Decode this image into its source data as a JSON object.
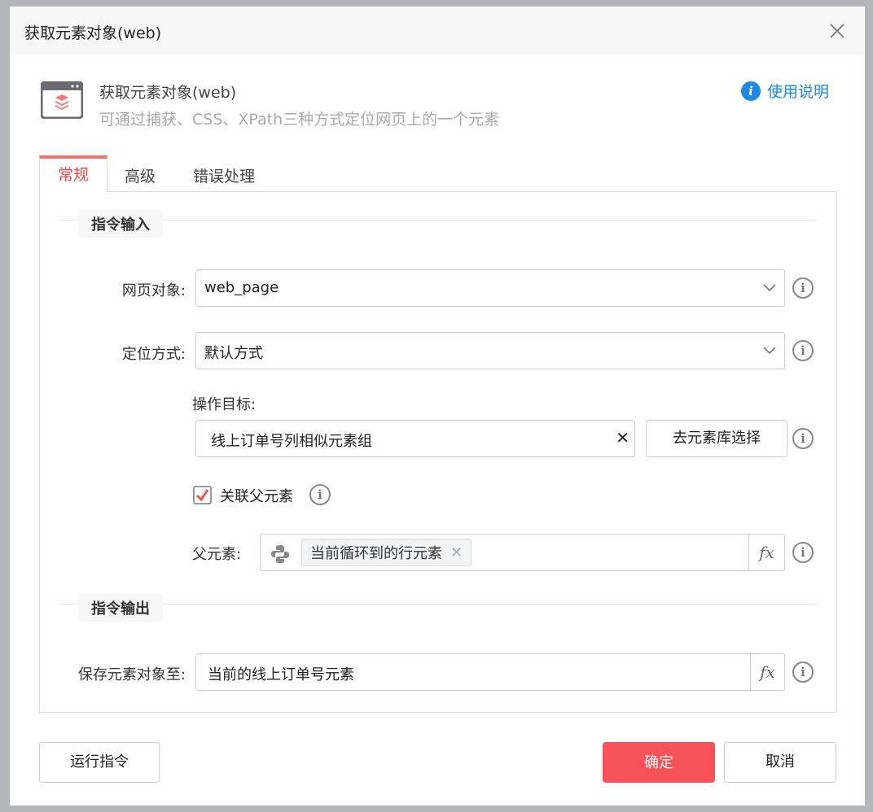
{
  "dialog": {
    "title": "获取元素对象(web)",
    "close_icon": "close-icon"
  },
  "header": {
    "title": "获取元素对象(web)",
    "subtitle": "可通过捕获、CSS、XPath三种方式定位网页上的一个元素",
    "help_link": "使用说明"
  },
  "tabs": [
    {
      "label": "常规",
      "active": true
    },
    {
      "label": "高级"
    },
    {
      "label": "错误处理"
    }
  ],
  "input_section": {
    "title": "指令输入",
    "web_page": {
      "label": "网页对象:",
      "value": "web_page"
    },
    "locate_mode": {
      "label": "定位方式:",
      "value": "默认方式"
    },
    "target": {
      "label": "操作目标:",
      "value": "线上订单号列相似元素组",
      "clear": "✕",
      "library_button": "去元素库选择"
    },
    "link_parent": {
      "label": "关联父元素",
      "checked": true
    },
    "parent": {
      "label": "父元素:",
      "tag": "当前循环到的行元素",
      "fx": "fx"
    }
  },
  "output_section": {
    "title": "指令输出",
    "save_to": {
      "label": "保存元素对象至:",
      "value": "当前的线上订单号元素",
      "fx": "fx"
    }
  },
  "footer": {
    "run": "运行指令",
    "ok": "确定",
    "cancel": "取消"
  },
  "colors": {
    "accent": "#f7525a",
    "link": "#1e88e5"
  }
}
